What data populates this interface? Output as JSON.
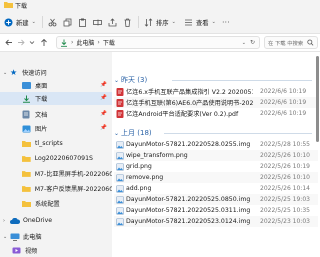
{
  "window": {
    "title": "下载"
  },
  "toolbar": {
    "new_label": "新建",
    "sort_label": "排序",
    "view_label": "查看",
    "more_label": "···"
  },
  "address": {
    "path": [
      "此电脑",
      "下载"
    ],
    "search_placeholder": "在 下载 中搜索"
  },
  "nav": {
    "items": [
      {
        "label": "快速访问",
        "icon": "star-icon",
        "pinned": false
      },
      {
        "label": "桌面",
        "icon": "desktop-folder-icon",
        "pinned": true
      },
      {
        "label": "下载",
        "icon": "download-folder-icon",
        "pinned": true
      },
      {
        "label": "文档",
        "icon": "documents-folder-icon",
        "pinned": true
      },
      {
        "label": "图片",
        "icon": "pictures-folder-icon",
        "pinned": true
      },
      {
        "label": "tl_scripts",
        "icon": "folder-icon",
        "pinned": false
      },
      {
        "label": "Log20220607091S",
        "icon": "folder-icon",
        "pinned": false
      },
      {
        "label": "M7-比亚黑屏手机-20220602-稿",
        "icon": "folder-icon",
        "pinned": false
      },
      {
        "label": "M7-客户反馈黑屏-20220606-稿",
        "icon": "folder-icon",
        "pinned": false
      },
      {
        "label": "系统配置",
        "icon": "folder-icon",
        "pinned": false
      },
      {
        "label": "OneDrive",
        "icon": "onedrive-icon",
        "pinned": false
      },
      {
        "label": "此电脑",
        "icon": "this-pc-icon",
        "pinned": false
      },
      {
        "label": "视频",
        "icon": "videos-folder-icon",
        "pinned": false
      }
    ]
  },
  "groups": [
    {
      "header": "昨天 (3)",
      "files": [
        {
          "name": "亿连6.x手机互联产品集成指引 V2.2 20200515.pdf",
          "date": "2022/6/6 10:19",
          "type": "pdf"
        },
        {
          "name": "亿连手机互联(第6)AE6.0产品使用说明书-20200421...",
          "date": "2022/6/6 10:19",
          "type": "pdf"
        },
        {
          "name": "亿连Android平台适配要求(Ver 0.2).pdf",
          "date": "2022/6/6 10:19",
          "type": "pdf"
        }
      ]
    },
    {
      "header": "上月 (18)",
      "files": [
        {
          "name": "DayunMotor-57821.20220528.0255.img",
          "date": "2022/5/28 10:55",
          "type": "img"
        },
        {
          "name": "wipe_transform.png",
          "date": "2022/5/26 10:10",
          "type": "img"
        },
        {
          "name": "grid.png",
          "date": "2022/5/26 10:19",
          "type": "img"
        },
        {
          "name": "remove.png",
          "date": "2022/5/26 10:10",
          "type": "img"
        },
        {
          "name": "add.png",
          "date": "2022/5/26 10:14",
          "type": "img"
        },
        {
          "name": "DayunMotor-57821.20220525.0850.img",
          "date": "2022/5/25 19:03",
          "type": "img"
        },
        {
          "name": "DayunMotor-57821.20220525.0311.img",
          "date": "2022/5/25 10:35",
          "type": "img"
        },
        {
          "name": "DayunMotor-57821.20220523.0124.img",
          "date": "2022/5/23 10:03",
          "type": "img"
        }
      ]
    }
  ],
  "colors": {
    "accent": "#0067c0",
    "folder": "#f4c13d",
    "pdf": "#d13438",
    "group_header": "#2a62a6"
  }
}
